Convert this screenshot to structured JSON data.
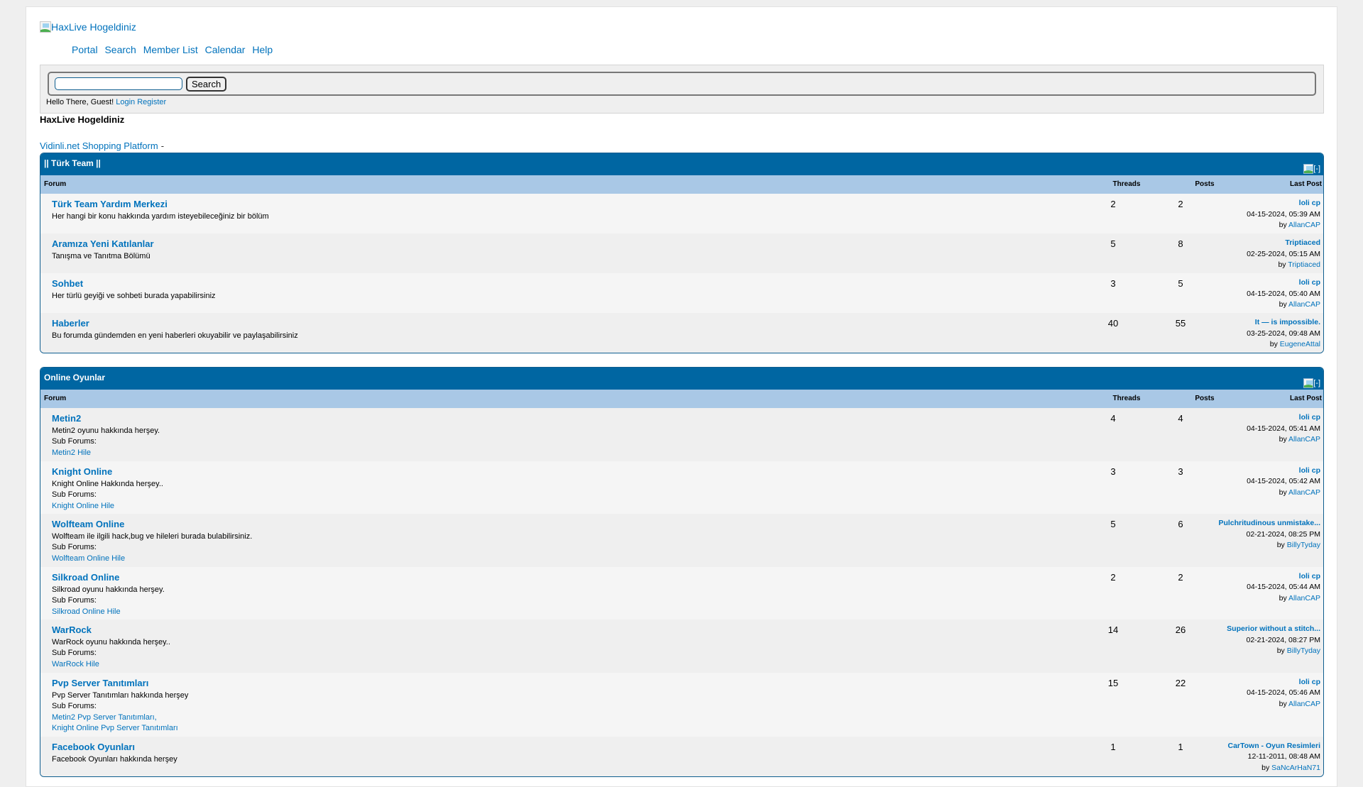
{
  "header": {
    "logo_alt": "HaxLive Hogeldiniz",
    "menu": [
      "Portal",
      "Search",
      "Member List",
      "Calendar",
      "Help"
    ]
  },
  "panel": {
    "search_value": "",
    "search_button": "Search",
    "welcome_text": "Hello There, Guest!",
    "login_label": "Login",
    "register_label": "Register"
  },
  "board_title": "HaxLive Hogeldiniz",
  "sponsor": {
    "link": "Vidinli.net Shopping Platform",
    "separator": "-"
  },
  "columns": {
    "forum": "Forum",
    "threads": "Threads",
    "posts": "Posts",
    "last_post": "Last Post"
  },
  "collapse_label": "[-]",
  "colors": {
    "category_header": "#0066a2",
    "table_header": "#a9c8e6",
    "link": "#0072bc"
  },
  "categories": [
    {
      "title": "|| Türk Team ||",
      "forums": [
        {
          "name": "Türk Team Yardım Merkezi",
          "desc": "Her hangi bir konu hakkında yardım isteyebileceğiniz bir bölüm",
          "threads": "2",
          "posts": "2",
          "last_title": "loli cp",
          "last_date": "04-15-2024, 05:39 AM",
          "last_by": "AllanCAP"
        },
        {
          "name": "Aramıza Yeni Katılanlar",
          "desc": "Tanışma ve Tanıtma Bölümü",
          "threads": "5",
          "posts": "8",
          "last_title": "Triptiaced",
          "last_date": "02-25-2024, 05:15 AM",
          "last_by": "Triptiaced"
        },
        {
          "name": "Sohbet",
          "desc": "Her türlü geyiği ve sohbeti burada yapabilirsiniz",
          "threads": "3",
          "posts": "5",
          "last_title": "loli cp",
          "last_date": "04-15-2024, 05:40 AM",
          "last_by": "AllanCAP"
        },
        {
          "name": "Haberler",
          "desc": "Bu forumda gündemden en yeni haberleri okuyabilir ve paylaşabilirsiniz",
          "threads": "40",
          "posts": "55",
          "last_title": "It — is impossible.",
          "last_date": "03-25-2024, 09:48 AM",
          "last_by": "EugeneAttal"
        }
      ]
    },
    {
      "title": "Online Oyunlar",
      "forums": [
        {
          "name": "Metin2",
          "desc": "Metin2 oyunu hakkında herşey.",
          "subs_label": "Sub Forums:",
          "subs": [
            "Metin2 Hile"
          ],
          "threads": "4",
          "posts": "4",
          "last_title": "loli cp",
          "last_date": "04-15-2024, 05:41 AM",
          "last_by": "AllanCAP"
        },
        {
          "name": "Knight Online",
          "desc": "Knight Online Hakkında herşey..",
          "subs_label": "Sub Forums:",
          "subs": [
            "Knight Online Hile"
          ],
          "threads": "3",
          "posts": "3",
          "last_title": "loli cp",
          "last_date": "04-15-2024, 05:42 AM",
          "last_by": "AllanCAP"
        },
        {
          "name": "Wolfteam Online",
          "desc": "Wolfteam ile ilgili hack,bug ve hileleri burada bulabilirsiniz.",
          "subs_label": "Sub Forums:",
          "subs": [
            "Wolfteam Online Hile"
          ],
          "threads": "5",
          "posts": "6",
          "last_title": "Pulchritudinous unmistake...",
          "last_date": "02-21-2024, 08:25 PM",
          "last_by": "BillyTyday"
        },
        {
          "name": "Silkroad Online",
          "desc": "Silkroad oyunu hakkında herşey.",
          "subs_label": "Sub Forums:",
          "subs": [
            "Silkroad Online Hile"
          ],
          "threads": "2",
          "posts": "2",
          "last_title": "loli cp",
          "last_date": "04-15-2024, 05:44 AM",
          "last_by": "AllanCAP"
        },
        {
          "name": "WarRock",
          "desc": "WarRock oyunu hakkında herşey..",
          "subs_label": "Sub Forums:",
          "subs": [
            "WarRock Hile"
          ],
          "threads": "14",
          "posts": "26",
          "last_title": "Superior without a stitch...",
          "last_date": "02-21-2024, 08:27 PM",
          "last_by": "BillyTyday"
        },
        {
          "name": "Pvp Server Tanıtımları",
          "desc": "Pvp Server Tanıtımları hakkında herşey",
          "subs_label": "Sub Forums:",
          "subs": [
            "Metin2 Pvp Server Tanıtımları,",
            "Knight Online Pvp Server Tanıtımları"
          ],
          "threads": "15",
          "posts": "22",
          "last_title": "loli cp",
          "last_date": "04-15-2024, 05:46 AM",
          "last_by": "AllanCAP"
        },
        {
          "name": "Facebook Oyunları",
          "desc": "Facebook Oyunları hakkında herşey",
          "threads": "1",
          "posts": "1",
          "last_title": "CarTown - Oyun Resimleri",
          "last_date": "12-11-2011, 08:48 AM",
          "last_by": "SaNcArHaN71"
        }
      ]
    }
  ],
  "by_label": "by"
}
